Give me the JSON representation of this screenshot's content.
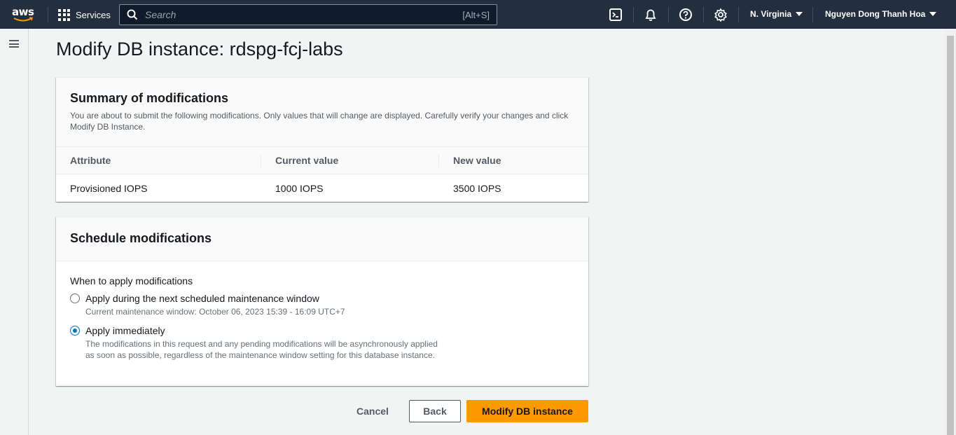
{
  "topnav": {
    "logo_text": "aws",
    "services_label": "Services",
    "search_placeholder": "Search",
    "search_shortcut": "[Alt+S]",
    "region": "N. Virginia",
    "user": "Nguyen Dong Thanh Hoa",
    "icons": [
      "cloudshell-icon",
      "bell-icon",
      "help-icon",
      "gear-icon"
    ]
  },
  "page": {
    "title": "Modify DB instance: rdspg-fcj-labs"
  },
  "summary": {
    "title": "Summary of modifications",
    "description": "You are about to submit the following modifications. Only values that will change are displayed. Carefully verify your changes and click Modify DB Instance.",
    "columns": [
      "Attribute",
      "Current value",
      "New value"
    ],
    "rows": [
      [
        "Provisioned IOPS",
        "1000 IOPS",
        "3500 IOPS"
      ]
    ]
  },
  "schedule": {
    "title": "Schedule modifications",
    "when_label": "When to apply modifications",
    "options": [
      {
        "label": "Apply during the next scheduled maintenance window",
        "description": "Current maintenance window: October 06, 2023 15:39 - 16:09 UTC+7",
        "selected": false
      },
      {
        "label": "Apply immediately",
        "description": "The modifications in this request and any pending modifications will be asynchronously applied as soon as possible, regardless of the maintenance window setting for this database instance.",
        "selected": true
      }
    ]
  },
  "actions": {
    "cancel": "Cancel",
    "back": "Back",
    "primary": "Modify DB instance"
  },
  "colors": {
    "nav_bg": "#232f3e",
    "primary_button": "#ff9900",
    "radio_selected": "#0073bb"
  }
}
